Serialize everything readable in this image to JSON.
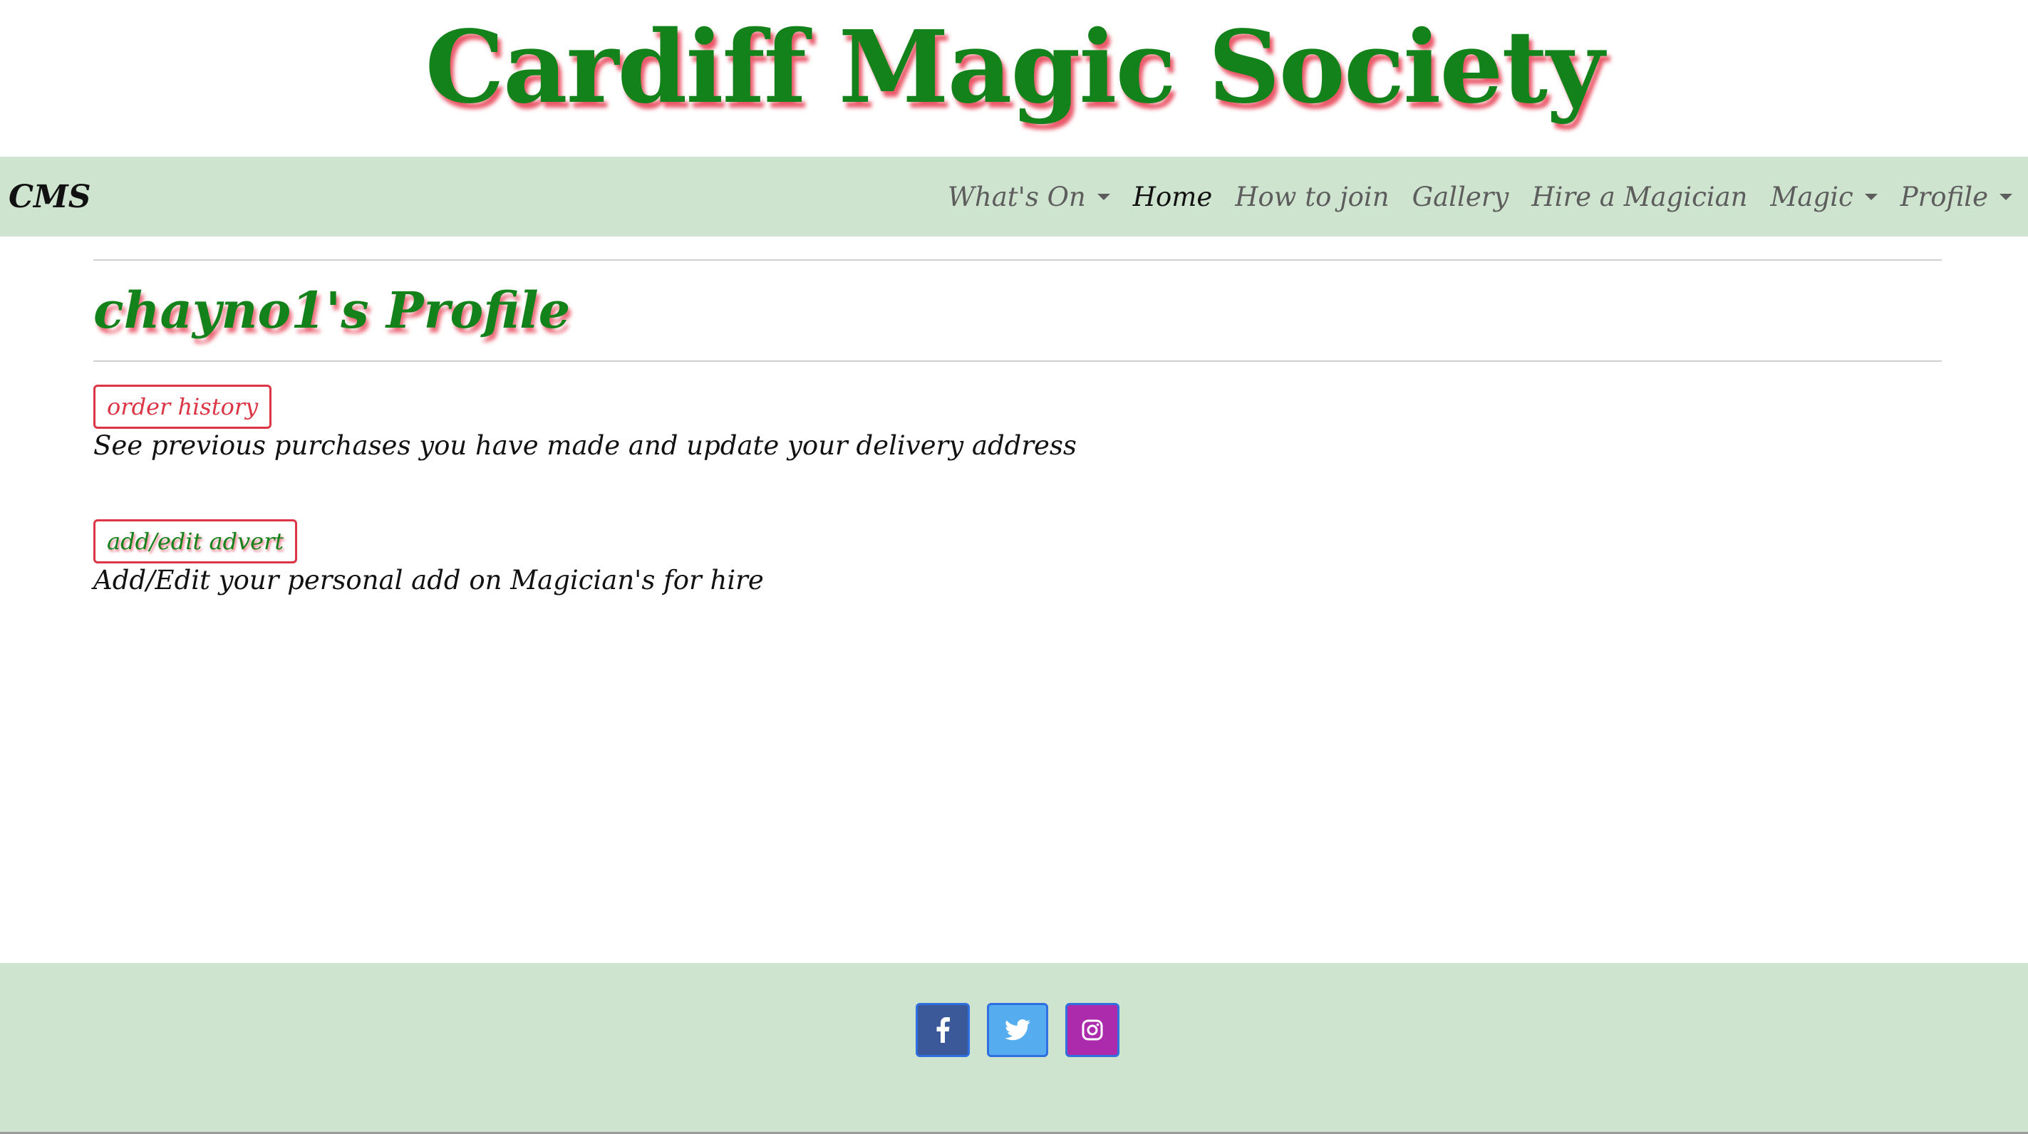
{
  "site": {
    "title": "Cardiff Magic Society"
  },
  "navbar": {
    "brand": "CMS",
    "items": [
      {
        "label": "What's On",
        "dropdown": true,
        "active": false
      },
      {
        "label": "Home",
        "dropdown": false,
        "active": true
      },
      {
        "label": "How to join",
        "dropdown": false,
        "active": false
      },
      {
        "label": "Gallery",
        "dropdown": false,
        "active": false
      },
      {
        "label": "Hire a Magician",
        "dropdown": false,
        "active": false
      },
      {
        "label": "Magic",
        "dropdown": true,
        "active": false
      },
      {
        "label": "Profile",
        "dropdown": true,
        "active": false
      }
    ]
  },
  "main": {
    "title": "chayno1's Profile",
    "sections": [
      {
        "button_label": "order history",
        "description": "See previous purchases you have made and update your delivery address"
      },
      {
        "button_label": "add/edit advert",
        "description": "Add/Edit your personal add on Magician's for hire"
      }
    ]
  },
  "footer": {
    "social": [
      {
        "name": "facebook-icon",
        "color": "#3b5998"
      },
      {
        "name": "twitter-icon",
        "color": "#55acee"
      },
      {
        "name": "instagram-icon",
        "color": "#ac2bac"
      }
    ]
  },
  "colors": {
    "accent_green": "#13821a",
    "shadow_red": "#e63c50",
    "nav_bg": "#cfe4cf",
    "outline_red": "#dc3545"
  }
}
